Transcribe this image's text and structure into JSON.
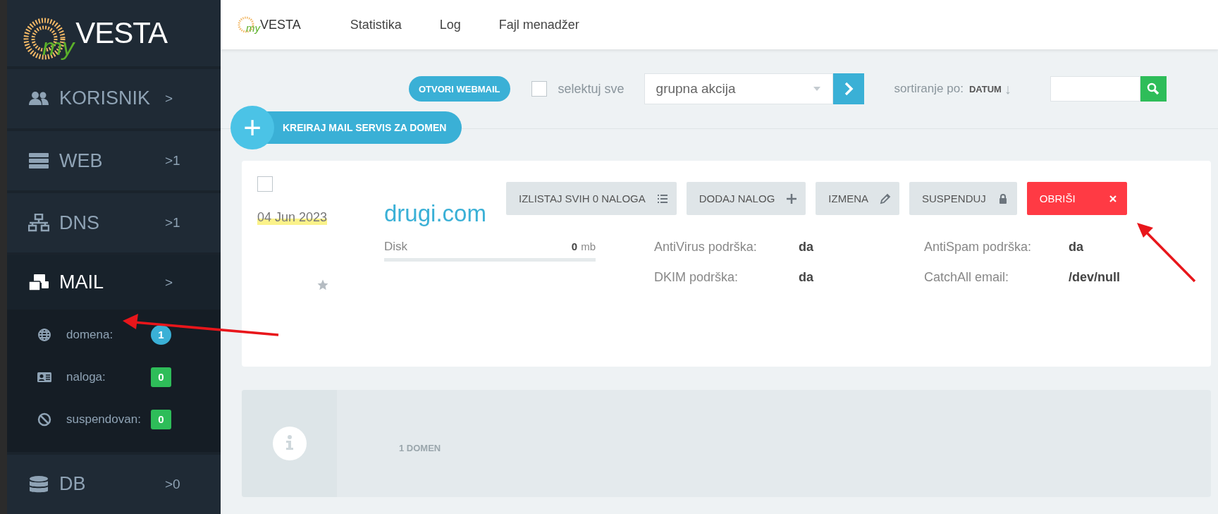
{
  "sidebar": {
    "logo": {
      "prefix": "my",
      "name": "VESTA"
    },
    "items": [
      {
        "kind": "users",
        "label": "KORISNIK",
        "arrow": ">",
        "selected": false
      },
      {
        "kind": "server",
        "label": "WEB",
        "arrow": ">",
        "count": "1",
        "selected": false
      },
      {
        "kind": "network",
        "label": "DNS",
        "arrow": ">",
        "count": "1",
        "selected": false
      },
      {
        "kind": "mail",
        "label": "MAIL",
        "arrow": ">",
        "selected": true,
        "children": [
          {
            "kind": "globe",
            "label": "domena:",
            "count": "1",
            "color": "#3ab0d6"
          },
          {
            "kind": "card",
            "label": "naloga:",
            "count": "0",
            "color": "#2ebd59"
          },
          {
            "kind": "ban",
            "label": "suspendovan:",
            "count": "0",
            "color": "#2ebd59"
          }
        ]
      },
      {
        "kind": "database",
        "label": "DB",
        "arrow": ">",
        "count": "0",
        "selected": false
      }
    ]
  },
  "topnav": {
    "logo": {
      "prefix": "my",
      "name": "VESTA"
    },
    "links": [
      "Statistika",
      "Log",
      "Fajl menadžer"
    ]
  },
  "toolbar": {
    "webmail_button": "OTVORI WEBMAIL",
    "select_all": {
      "label": "selektuj sve",
      "checked": false
    },
    "bulk_action": {
      "value": "grupna akcija"
    },
    "sort": {
      "label": "sortiranje po:",
      "value": "DATUM",
      "arrow": "↓"
    },
    "add_button": {
      "icon": "+",
      "label": "KREIRAJ MAIL SERVIS ZA DOMEN"
    }
  },
  "domains": [
    {
      "checked": false,
      "date": "04  Jun  2023",
      "starred": false,
      "name": "drugi.com",
      "actions": [
        {
          "kind": "list",
          "label": "IZLISTAJ SVIH 0 NALOGA"
        },
        {
          "kind": "add",
          "label": "DODAJ NALOG"
        },
        {
          "kind": "edit",
          "label": "IZMENA"
        },
        {
          "kind": "lock",
          "label": "SUSPENDUJ"
        },
        {
          "kind": "delete",
          "label": "OBRIŠI"
        }
      ],
      "disk": {
        "label": "Disk",
        "value": "0",
        "unit": "mb",
        "level": 0
      },
      "stats": [
        {
          "label": "AntiVirus podrška:",
          "value": "da"
        },
        {
          "label": "AntiSpam podrška:",
          "value": "da"
        },
        {
          "label": "DKIM podrška:",
          "value": "da"
        },
        {
          "label": "CatchAll email:",
          "value": "/dev/null"
        }
      ]
    }
  ],
  "summary": {
    "text": "1 DOMEN"
  }
}
